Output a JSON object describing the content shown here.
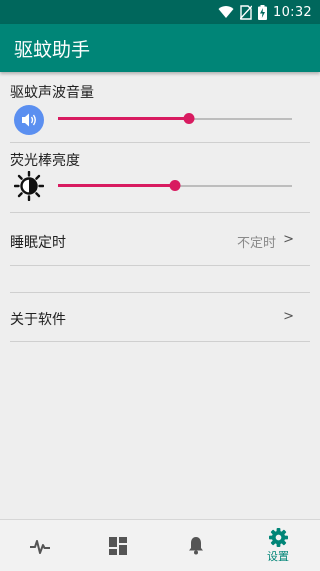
{
  "status_bar": {
    "time": "10:32",
    "icons": [
      "wifi-icon",
      "no-sim-icon",
      "battery-charging-icon"
    ]
  },
  "app_bar": {
    "title": "驱蚊助手"
  },
  "settings": {
    "sound_volume": {
      "label": "驱蚊声波音量",
      "icon": "speaker-icon",
      "value_fraction": 0.56
    },
    "light_brightness": {
      "label": "荧光棒亮度",
      "icon": "brightness-icon",
      "value_fraction": 0.5
    },
    "sleep_timer": {
      "label": "睡眠定时",
      "value": "不定时",
      "chevron": ">"
    },
    "about": {
      "label": "关于软件",
      "chevron": ">"
    }
  },
  "bottom_nav": {
    "items": [
      {
        "icon": "pulse-icon",
        "label": ""
      },
      {
        "icon": "grid-icon",
        "label": ""
      },
      {
        "icon": "bell-icon",
        "label": ""
      },
      {
        "icon": "gear-icon",
        "label": "设置",
        "active": true
      }
    ]
  },
  "colors": {
    "app_bar": "#008577",
    "status_bar": "#00675c",
    "accent": "#d81b60",
    "icon_blue": "#5b8ff0"
  }
}
